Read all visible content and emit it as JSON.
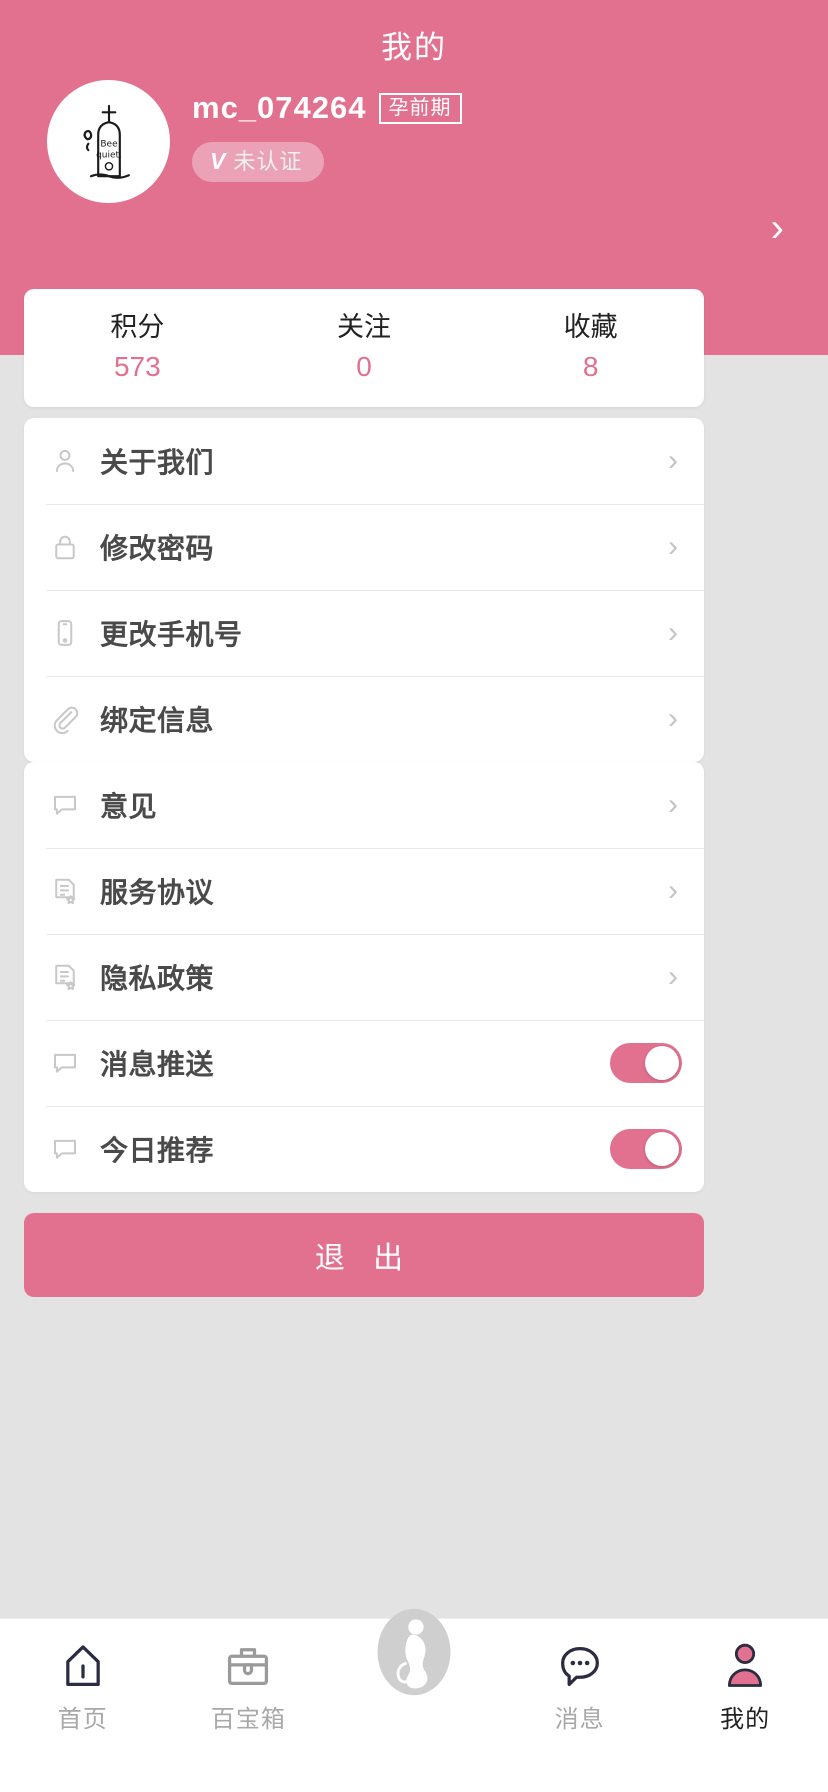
{
  "theme": {
    "accent": "#e2718f",
    "page_background": "#e3e3e3",
    "card_background": "#ffffff",
    "label_color": "#4a4a4a",
    "icon_color": "#c8c8c8"
  },
  "header": {
    "title": "我的",
    "username": "mc_074264",
    "stage_badge": "孕前期",
    "verify_icon": "V",
    "verify_label": "未认证",
    "arrow": "›",
    "avatar_alt": "tombstone-bee-quiet-drawing"
  },
  "stats": [
    {
      "label": "积分",
      "value": "573"
    },
    {
      "label": "关注",
      "value": "0"
    },
    {
      "label": "收藏",
      "value": "8"
    }
  ],
  "groups": [
    {
      "id": "account",
      "rows": [
        {
          "icon": "person-icon",
          "label": "关于我们",
          "arrow": "›",
          "type": "link"
        },
        {
          "icon": "lock-icon",
          "label": "修改密码",
          "arrow": "›",
          "type": "link"
        },
        {
          "icon": "phone-icon",
          "label": "更改手机号",
          "arrow": "›",
          "type": "link"
        },
        {
          "icon": "paperclip-icon",
          "label": "绑定信息",
          "arrow": "›",
          "type": "link"
        }
      ]
    },
    {
      "id": "general",
      "rows": [
        {
          "icon": "speech-bubble-icon",
          "label": "意见",
          "arrow": "›",
          "type": "link"
        },
        {
          "icon": "document-star-icon",
          "label": "服务协议",
          "arrow": "›",
          "type": "link"
        },
        {
          "icon": "document-star-icon",
          "label": "隐私政策",
          "arrow": "›",
          "type": "link"
        },
        {
          "icon": "speech-bubble-icon",
          "label": "消息推送",
          "type": "toggle",
          "on": true
        },
        {
          "icon": "speech-bubble-icon",
          "label": "今日推荐",
          "type": "toggle",
          "on": true
        }
      ]
    }
  ],
  "logout": {
    "label": "退 出"
  },
  "tabbar": [
    {
      "icon": "home-icon",
      "label": "首页",
      "active": false
    },
    {
      "icon": "toolbox-icon",
      "label": "百宝箱",
      "active": false
    },
    {
      "icon": "pregnant-woman-icon",
      "label": "",
      "active": false
    },
    {
      "icon": "message-icon",
      "label": "消息",
      "active": false
    },
    {
      "icon": "user-icon",
      "label": "我的",
      "active": true
    }
  ]
}
